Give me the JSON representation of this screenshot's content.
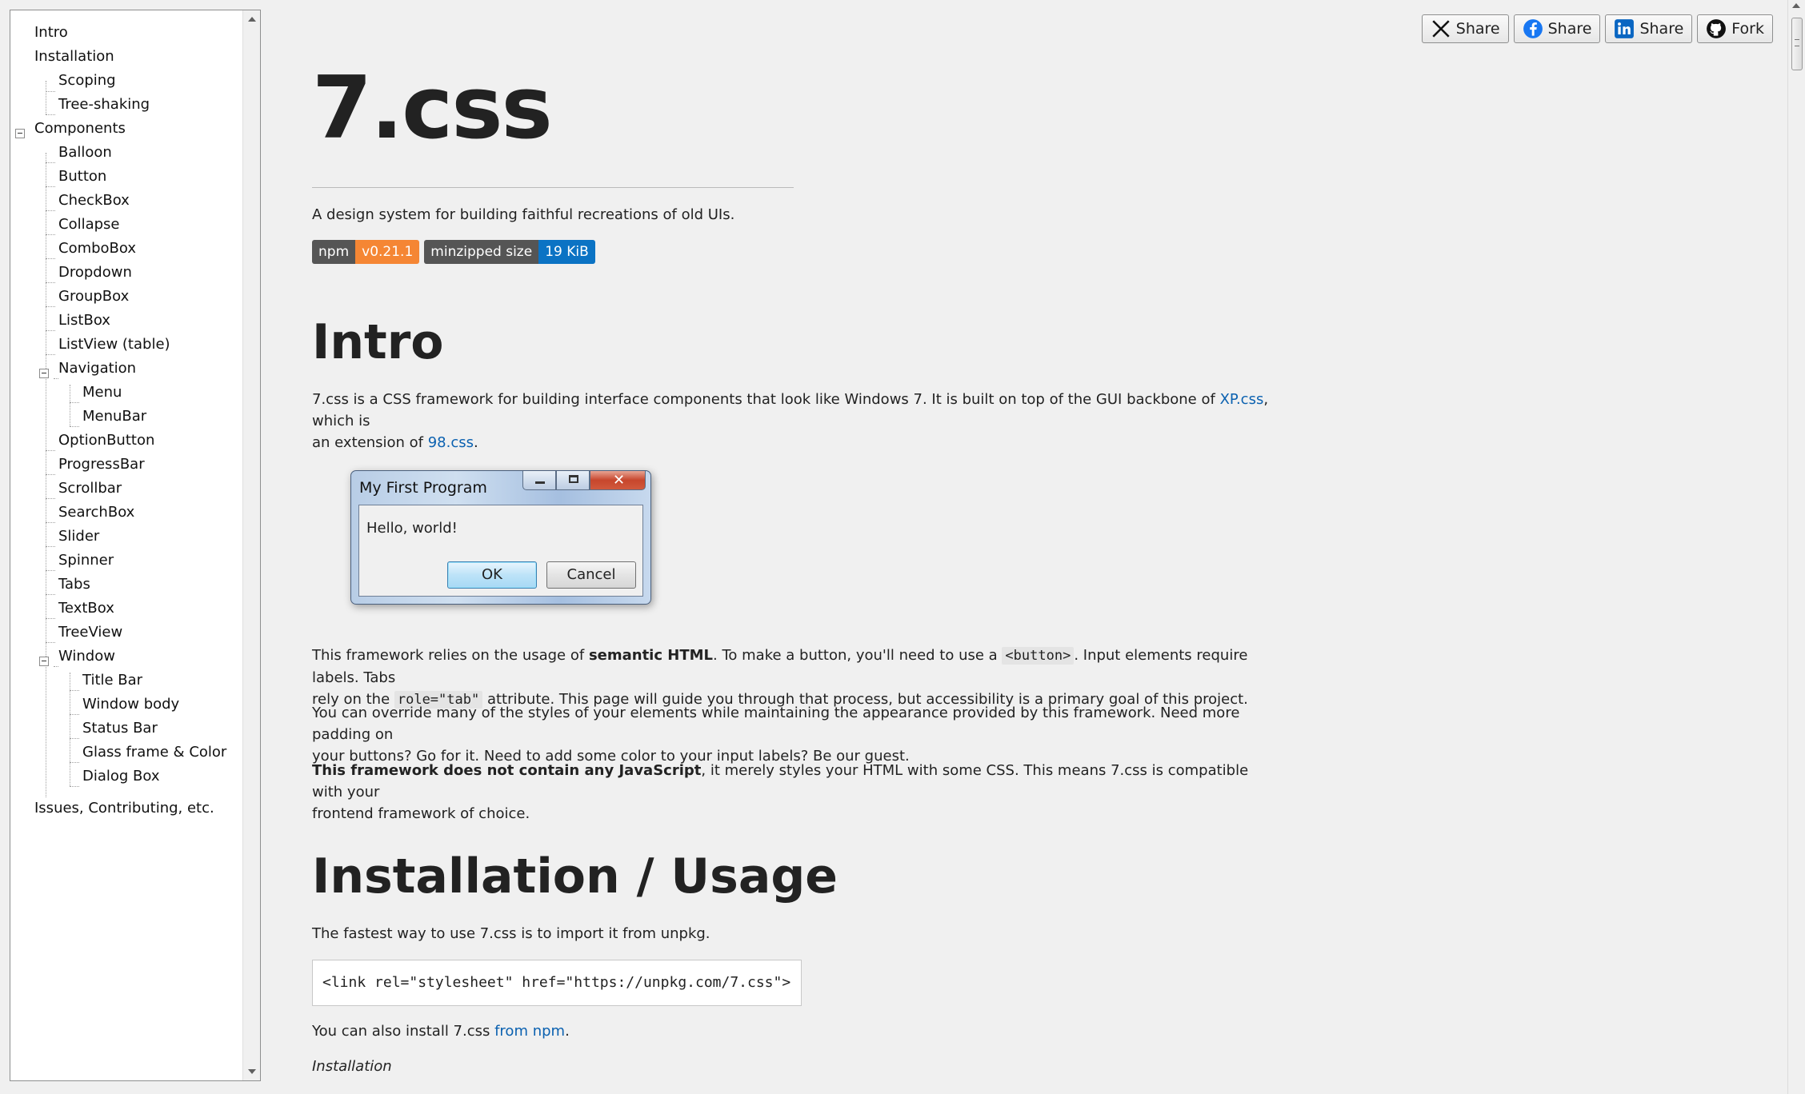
{
  "sidebar": {
    "items": [
      {
        "label": "Intro"
      },
      {
        "label": "Installation"
      },
      {
        "label": "Scoping"
      },
      {
        "label": "Tree-shaking"
      },
      {
        "label": "Components"
      },
      {
        "label": "Balloon"
      },
      {
        "label": "Button"
      },
      {
        "label": "CheckBox"
      },
      {
        "label": "Collapse"
      },
      {
        "label": "ComboBox"
      },
      {
        "label": "Dropdown"
      },
      {
        "label": "GroupBox"
      },
      {
        "label": "ListBox"
      },
      {
        "label": "ListView (table)"
      },
      {
        "label": "Navigation"
      },
      {
        "label": "Menu"
      },
      {
        "label": "MenuBar"
      },
      {
        "label": "OptionButton"
      },
      {
        "label": "ProgressBar"
      },
      {
        "label": "Scrollbar"
      },
      {
        "label": "SearchBox"
      },
      {
        "label": "Slider"
      },
      {
        "label": "Spinner"
      },
      {
        "label": "Tabs"
      },
      {
        "label": "TextBox"
      },
      {
        "label": "TreeView"
      },
      {
        "label": "Window"
      },
      {
        "label": "Title Bar"
      },
      {
        "label": "Window body"
      },
      {
        "label": "Status Bar"
      },
      {
        "label": "Glass frame & Color"
      },
      {
        "label": "Dialog Box"
      },
      {
        "label": "Issues, Contributing, etc."
      }
    ]
  },
  "share": {
    "x": {
      "label": "Share",
      "icon": "x-logo-icon"
    },
    "facebook": {
      "label": "Share",
      "icon": "facebook-icon"
    },
    "linkedin": {
      "label": "Share",
      "icon": "linkedin-icon"
    },
    "github": {
      "label": "Fork",
      "icon": "github-icon"
    }
  },
  "header": {
    "title": "7.css",
    "tagline": "A design system for building faithful recreations of old UIs."
  },
  "badges": {
    "npm": {
      "label": "npm",
      "value": "v0.21.1",
      "color": "#f58634"
    },
    "size": {
      "label": "minzipped size",
      "value": "19 KiB",
      "color": "#0b73c4"
    }
  },
  "intro": {
    "heading": "Intro",
    "p1_a": "7.css is a CSS framework for building interface components that look like Windows 7. It is built on top of the GUI backbone of ",
    "p1_link1": "XP.css",
    "p1_b": ", which is",
    "p1_c": "an extension of ",
    "p1_link2": "98.css",
    "p1_d": ".",
    "p2_a": "This framework relies on the usage of ",
    "p2_bold": "semantic HTML",
    "p2_b": ". To make a button, you'll need to use a ",
    "p2_code1": "<button>",
    "p2_c": ". Input elements require labels. Tabs",
    "p2_d": "rely on the ",
    "p2_code2": "role=\"tab\"",
    "p2_e": " attribute. This page will guide you through that process, but accessibility is a primary goal of this project.",
    "p3_line1": "You can override many of the styles of your elements while maintaining the appearance provided by this framework. Need more padding on",
    "p3_line2": "your buttons? Go for it. Need to add some color to your input labels? Be our guest.",
    "p4_bold": "This framework does not contain any JavaScript",
    "p4_a": ", it merely styles your HTML with some CSS. This means 7.css is compatible with your",
    "p4_line2": "frontend framework of choice."
  },
  "dialog": {
    "title": "My First Program",
    "message": "Hello, world!",
    "ok": "OK",
    "cancel": "Cancel"
  },
  "install": {
    "heading": "Installation / Usage",
    "p1": "The fastest way to use 7.css is to import it from unpkg.",
    "code": "<link rel=\"stylesheet\" href=\"https://unpkg.com/7.css\">",
    "p2_a": "You can also install 7.css ",
    "p2_link": "from npm",
    "p2_b": ".",
    "subheading": "Installation"
  }
}
